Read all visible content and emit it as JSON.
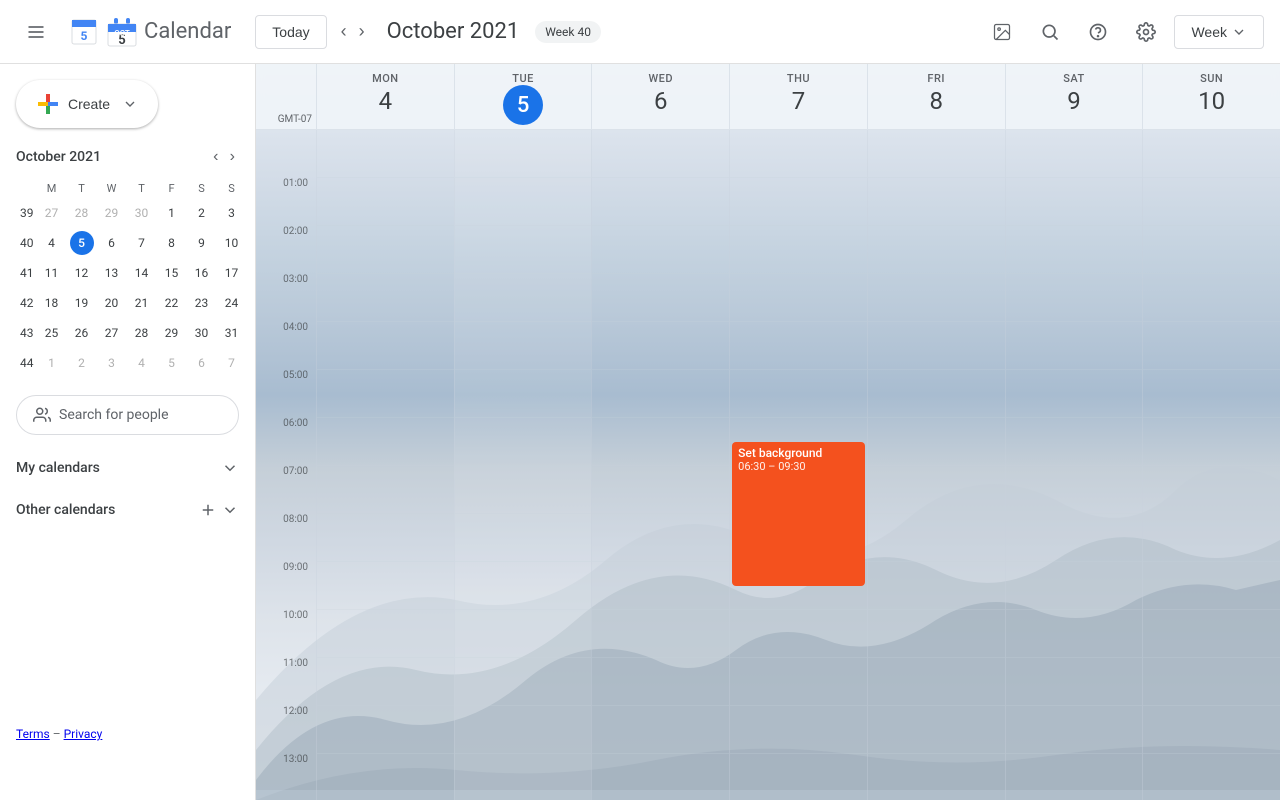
{
  "app": {
    "title": "Calendar",
    "logo_alt": "Google Calendar"
  },
  "header": {
    "menu_label": "☰",
    "today_label": "Today",
    "prev_label": "‹",
    "next_label": "›",
    "month_year": "October 2021",
    "week_badge": "Week 40",
    "view_label": "Week",
    "icons": {
      "photo": "🖼",
      "search": "🔍",
      "help": "?",
      "settings": "⚙"
    }
  },
  "sidebar": {
    "create_label": "Create",
    "mini_cal": {
      "title": "October 2021",
      "weekdays": [
        "M",
        "T",
        "W",
        "T",
        "F",
        "S",
        "S"
      ],
      "weeks": [
        {
          "num": "39",
          "days": [
            {
              "d": "27",
              "om": true
            },
            {
              "d": "28",
              "om": true
            },
            {
              "d": "29",
              "om": true
            },
            {
              "d": "30",
              "om": true
            },
            {
              "d": "1"
            },
            {
              "d": "2"
            },
            {
              "d": "3"
            }
          ]
        },
        {
          "num": "40",
          "days": [
            {
              "d": "4"
            },
            {
              "d": "5",
              "today": true
            },
            {
              "d": "6"
            },
            {
              "d": "7"
            },
            {
              "d": "8"
            },
            {
              "d": "9"
            },
            {
              "d": "10"
            }
          ]
        },
        {
          "num": "41",
          "days": [
            {
              "d": "11"
            },
            {
              "d": "12"
            },
            {
              "d": "13"
            },
            {
              "d": "14"
            },
            {
              "d": "15"
            },
            {
              "d": "16"
            },
            {
              "d": "17"
            }
          ]
        },
        {
          "num": "42",
          "days": [
            {
              "d": "18"
            },
            {
              "d": "19"
            },
            {
              "d": "20"
            },
            {
              "d": "21"
            },
            {
              "d": "22"
            },
            {
              "d": "23"
            },
            {
              "d": "24"
            }
          ]
        },
        {
          "num": "43",
          "days": [
            {
              "d": "25"
            },
            {
              "d": "26"
            },
            {
              "d": "27"
            },
            {
              "d": "28"
            },
            {
              "d": "29"
            },
            {
              "d": "30"
            },
            {
              "d": "31"
            }
          ]
        },
        {
          "num": "44",
          "days": [
            {
              "d": "1",
              "om": true
            },
            {
              "d": "2",
              "om": true
            },
            {
              "d": "3",
              "om": true
            },
            {
              "d": "4",
              "om": true
            },
            {
              "d": "5",
              "om": true
            },
            {
              "d": "6",
              "om": true
            },
            {
              "d": "7",
              "om": true
            }
          ]
        }
      ]
    },
    "search_people_placeholder": "Search for people",
    "my_calendars_label": "My calendars",
    "other_calendars_label": "Other calendars",
    "footer": {
      "terms": "Terms",
      "dash": "–",
      "privacy": "Privacy"
    }
  },
  "calendar": {
    "timezone": "GMT-07",
    "days": [
      {
        "name": "MON",
        "num": "4",
        "today": false
      },
      {
        "name": "TUE",
        "num": "5",
        "today": true
      },
      {
        "name": "WED",
        "num": "6",
        "today": false
      },
      {
        "name": "THU",
        "num": "7",
        "today": false
      },
      {
        "name": "FRI",
        "num": "8",
        "today": false
      },
      {
        "name": "SAT",
        "num": "9",
        "today": false
      },
      {
        "name": "SUN",
        "num": "10",
        "today": false
      }
    ],
    "time_labels": [
      "01:00",
      "02:00",
      "03:00",
      "04:00",
      "05:00",
      "06:00",
      "07:00",
      "08:00",
      "09:00",
      "10:00",
      "11:00",
      "12:00",
      "13:00"
    ],
    "event": {
      "title": "Set background",
      "time": "06:30 – 09:30",
      "color": "#f4511e",
      "day_index": 3,
      "start_hour": 6.5,
      "duration_hours": 3
    }
  }
}
